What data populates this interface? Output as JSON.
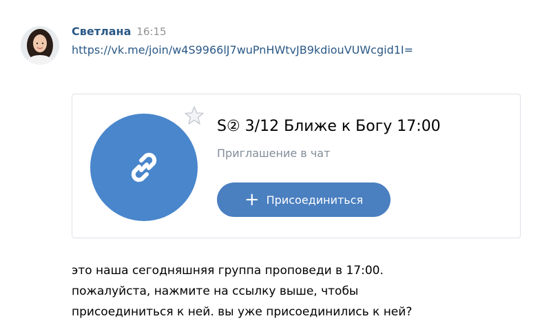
{
  "message": {
    "author": "Светлана",
    "time": "16:15",
    "link_text": "https://vk.me/join/w4S9966lJ7wuPnHWtvJB9kdiouVUWcgid1I=",
    "text_lines": [
      "это наша сегодняшняя группа проповеди в 17:00.",
      "пожалуйста, нажмите на ссылку выше, чтобы",
      "присоединиться к ней. вы уже присоединились к ней?"
    ]
  },
  "chat_card": {
    "title": "S② 3/12 Ближе к Богу 17:00",
    "subtitle": "Приглашение в чат",
    "join_button_label": "Присоединиться",
    "avatar_color": "#4986cc",
    "button_color": "#4a7fc0",
    "icons": {
      "chat_avatar": "link-icon",
      "favorite": "star-icon",
      "join": "plus-icon"
    }
  },
  "colors": {
    "author": "#2a5885",
    "link": "#2a5885",
    "time": "#939393",
    "subtitle": "#818c99"
  }
}
